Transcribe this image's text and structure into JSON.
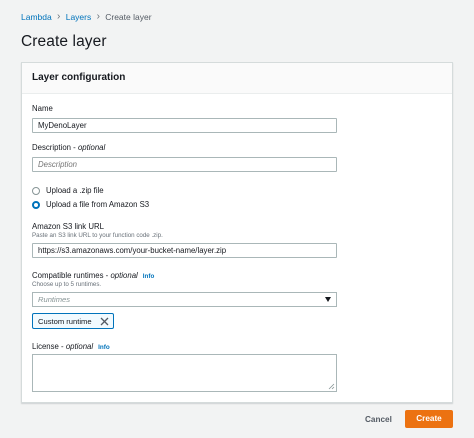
{
  "breadcrumb": {
    "items": [
      "Lambda",
      "Layers"
    ],
    "current": "Create layer",
    "separator": "›"
  },
  "page": {
    "title": "Create layer"
  },
  "panel": {
    "title": "Layer configuration",
    "name": {
      "label": "Name",
      "value": "MyDenoLayer"
    },
    "description": {
      "label": "Description",
      "optional": "optional",
      "placeholder": "Description",
      "value": ""
    },
    "upload": {
      "options": [
        "Upload a .zip file",
        "Upload a file from Amazon S3"
      ],
      "selected_index": 1
    },
    "s3": {
      "label": "Amazon S3 link URL",
      "hint": "Paste an S3 link URL to your function code .zip.",
      "value": "https://s3.amazonaws.com/your-bucket-name/layer.zip"
    },
    "runtimes": {
      "label": "Compatible runtimes",
      "optional": "optional",
      "info": "Info",
      "hint": "Choose up to 5 runtimes.",
      "placeholder": "Runtimes",
      "tokens": [
        "Custom runtime"
      ]
    },
    "license": {
      "label": "License",
      "optional": "optional",
      "info": "Info",
      "value": ""
    }
  },
  "actions": {
    "cancel": "Cancel",
    "create": "Create"
  },
  "colors": {
    "link": "#0073bb",
    "primary": "#ec7211",
    "background": "#f2f3f3",
    "border": "#aab7b8"
  }
}
